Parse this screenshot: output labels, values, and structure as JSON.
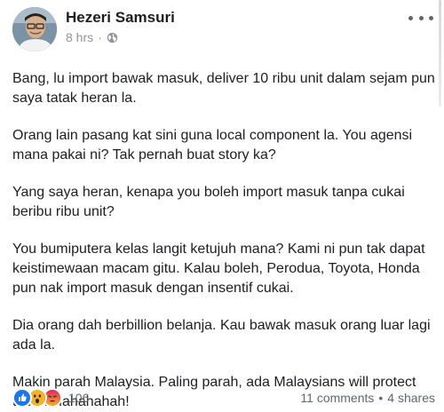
{
  "post": {
    "author": "Hezeri Samsuri",
    "time": "8 hrs",
    "separator": "·",
    "paragraphs": [
      "Bang, lu import bawak masuk, deliver 10 ribu unit dalam sejam pun saya tatak heran la.",
      "Orang lain pasang kat sini guna local component la. You agensi mana pakai ni? Tak pernah buat story ka?",
      "Yang saya heran, kenapa you boleh import masuk tanpa cukai beribu ribu unit?",
      "You bumiputera kelas langit ketujuh mana?  Kami ni pun tak dapat keistimewaan macam gitu. Kalau boleh, Perodua, Toyota, Honda pun nak import masuk dengan insentif cukai.",
      "Dia orang dah berbillion belanja. Kau bawak masuk orang luar lagi ada la.",
      "Makin parah Malaysia. Paling parah, ada Malaysians  will protect them. Hahahahah!"
    ]
  },
  "footer": {
    "reaction_count": "106",
    "comments": "11 comments",
    "bullet": "•",
    "shares": "4 shares",
    "reactions": [
      "like-icon",
      "wow-icon",
      "angry-icon"
    ]
  },
  "colors": {
    "like": "#1877f2",
    "wow": "#f7b125",
    "angry": "#e9710f",
    "meta_text": "#90949c"
  }
}
